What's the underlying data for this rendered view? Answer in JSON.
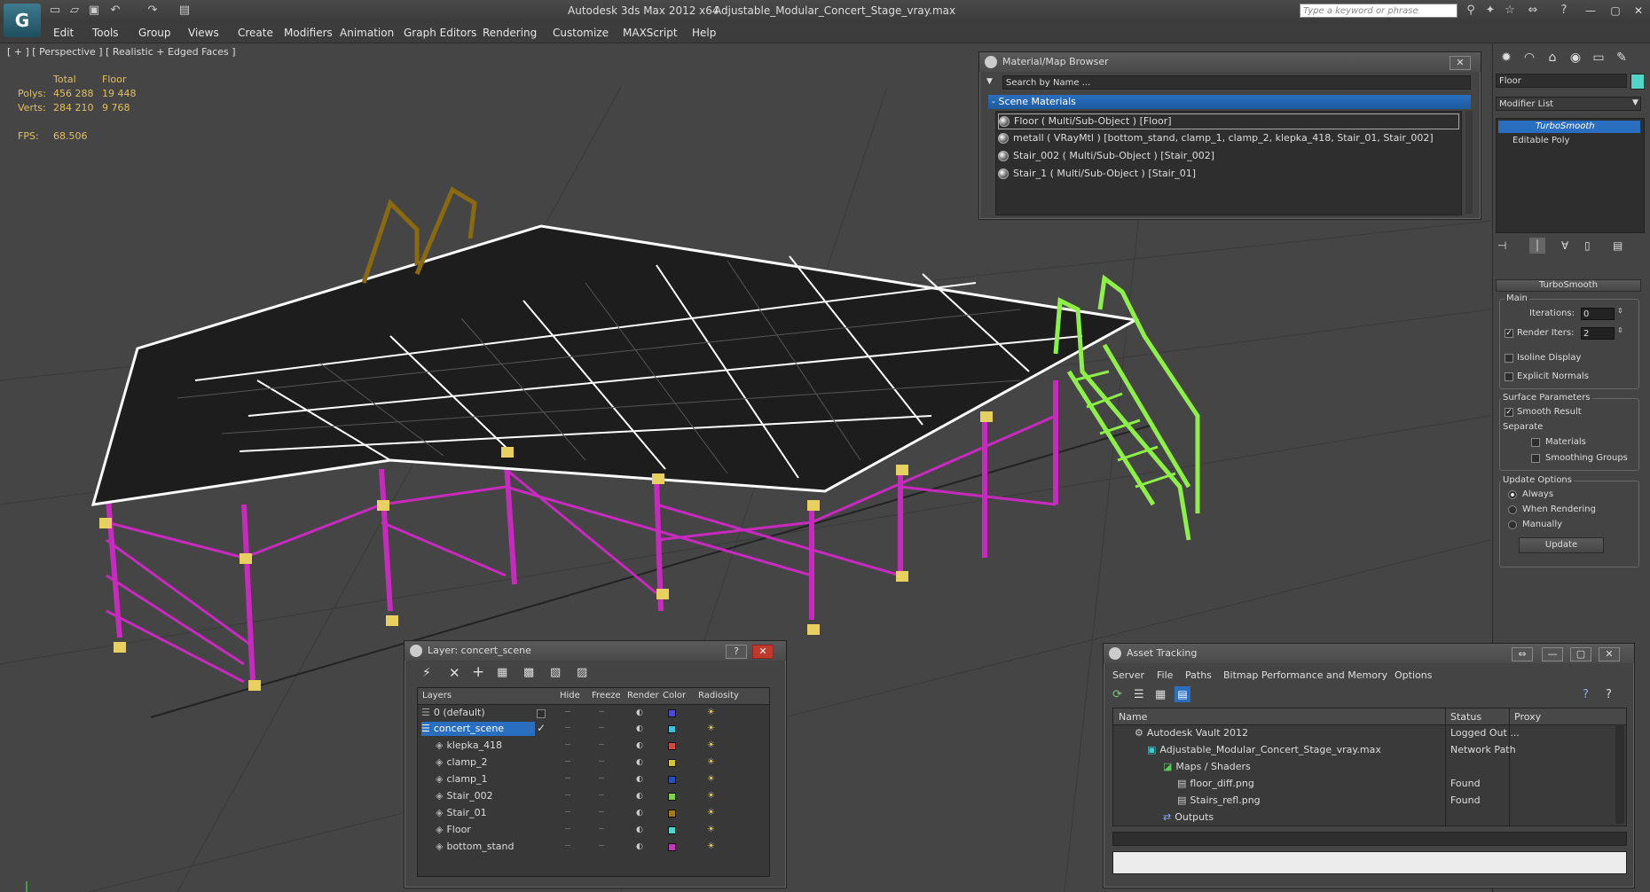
{
  "titlebar": {
    "app_title": "Autodesk 3ds Max  2012 x64",
    "file_name": "Adjustable_Modular_Concert_Stage_vray.max",
    "search_placeholder": "Type a keyword or phrase"
  },
  "menu": [
    "Edit",
    "Tools",
    "Group",
    "Views",
    "Create",
    "Modifiers",
    "Animation",
    "Graph Editors",
    "Rendering",
    "Customize",
    "MAXScript",
    "Help"
  ],
  "viewport": {
    "label": "[ + ] [ Perspective ] [ Realistic + Edged Faces ]",
    "stats": {
      "col_total": "Total",
      "col_floor": "Floor",
      "polys_label": "Polys:",
      "polys_total": "456 288",
      "polys_floor": "19 448",
      "verts_label": "Verts:",
      "verts_total": "284 210",
      "verts_floor": "9 768",
      "fps_label": "FPS:",
      "fps_value": "68.506"
    }
  },
  "material_browser": {
    "title": "Material/Map Browser",
    "search_placeholder": "Search by Name ...",
    "section": "- Scene Materials",
    "items": [
      "Floor  ( Multi/Sub-Object ) [Floor]",
      "metall  ( VRayMtl ) [bottom_stand, clamp_1, clamp_2, klepka_418, Stair_01, Stair_002]",
      "Stair_002  ( Multi/Sub-Object ) [Stair_002]",
      "Stair_1  ( Multi/Sub-Object ) [Stair_01]"
    ]
  },
  "command_panel": {
    "object_name": "Floor",
    "object_color": "#4fd6c8",
    "modifier_list": "Modifier List",
    "stack": [
      "TurboSmooth",
      "Editable Poly"
    ],
    "rollout_title": "TurboSmooth",
    "main_label": "Main",
    "iterations_label": "Iterations:",
    "iterations_value": "0",
    "render_iters_label": "Render Iters:",
    "render_iters_value": "2",
    "isoline": "Isoline Display",
    "explicit_normals": "Explicit Normals",
    "surface_params": "Surface Parameters",
    "smooth_result": "Smooth Result",
    "separate": "Separate",
    "materials": "Materials",
    "smoothing_groups": "Smoothing Groups",
    "update_options": "Update Options",
    "always": "Always",
    "when_rendering": "When Rendering",
    "manually": "Manually",
    "update_button": "Update"
  },
  "layer_panel": {
    "title": "Layer: concert_scene",
    "headers": [
      "Layers",
      "Hide",
      "Freeze",
      "Render",
      "Color",
      "Radiosity"
    ],
    "rows": [
      {
        "name": "0 (default)",
        "color": "#4b4bd0"
      },
      {
        "name": "concert_scene",
        "color": "#3ec0d8"
      },
      {
        "name": "klepka_418",
        "color": "#d04848"
      },
      {
        "name": "clamp_2",
        "color": "#d8c040"
      },
      {
        "name": "clamp_1",
        "color": "#2b4fb8"
      },
      {
        "name": "Stair_002",
        "color": "#7ed04a"
      },
      {
        "name": "Stair_01",
        "color": "#a07820"
      },
      {
        "name": "Floor",
        "color": "#4fd6c8"
      },
      {
        "name": "bottom_stand",
        "color": "#c03ab8"
      }
    ]
  },
  "asset_tracking": {
    "title": "Asset Tracking",
    "menu": [
      "Server",
      "File",
      "Paths",
      "Bitmap Performance and Memory",
      "Options"
    ],
    "headers": [
      "Name",
      "Status",
      "Proxy"
    ],
    "rows": [
      {
        "name": "Autodesk Vault 2012",
        "status": "Logged Out ..."
      },
      {
        "name": "Adjustable_Modular_Concert_Stage_vray.max",
        "status": "Network Path"
      },
      {
        "name": "Maps / Shaders",
        "status": ""
      },
      {
        "name": "floor_diff.png",
        "status": "Found"
      },
      {
        "name": "Stairs_refl.png",
        "status": "Found"
      },
      {
        "name": "Outputs",
        "status": ""
      }
    ]
  }
}
